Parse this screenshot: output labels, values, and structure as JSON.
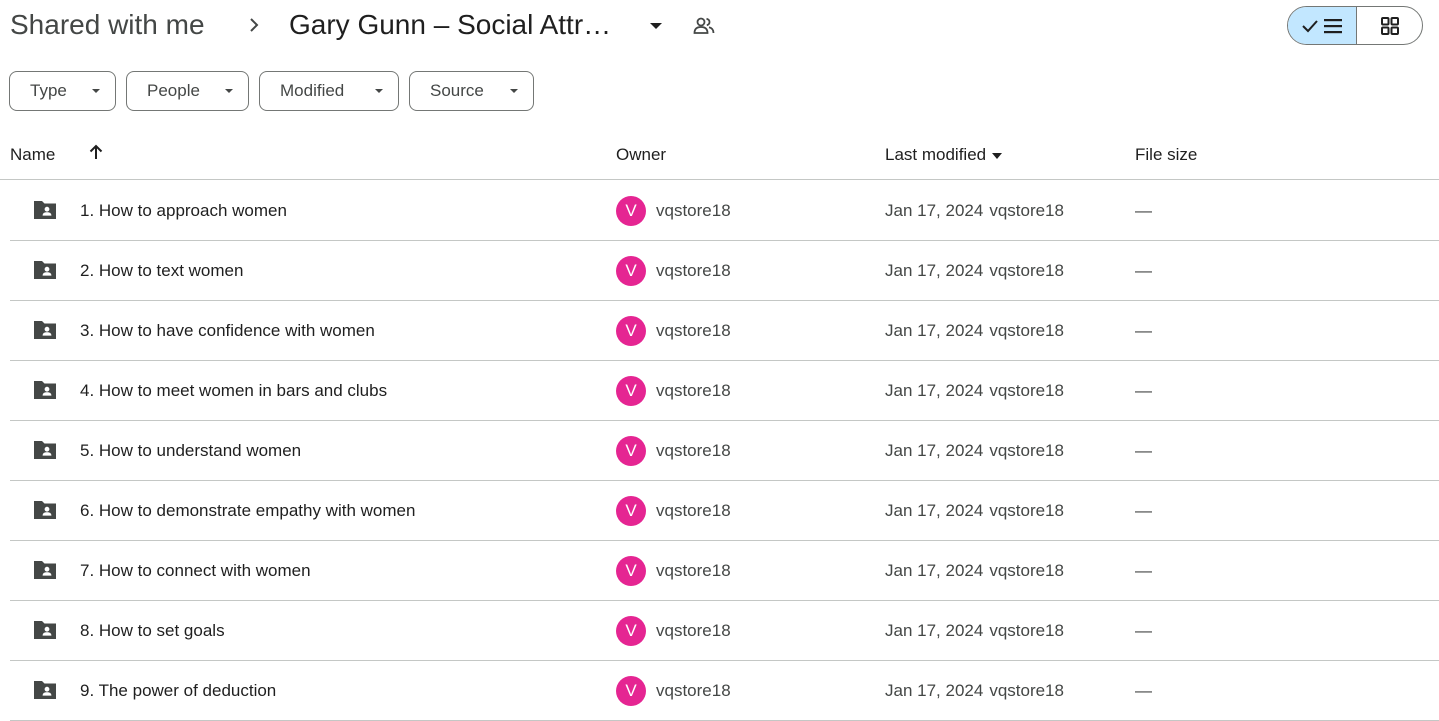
{
  "header": {
    "breadcrumb_root": "Shared with me",
    "breadcrumb_current": "Gary Gunn – Social Attr…",
    "separator_icon": "chevron-right-icon",
    "dropdown_icon": "caret-down-icon",
    "shared_icon": "people-icon"
  },
  "view_toggle": {
    "list_selected": true,
    "list_icons": [
      "check-icon",
      "list-icon"
    ],
    "grid_icon": "grid-icon",
    "selected_color": "#c2e7ff"
  },
  "filters": [
    {
      "label": "Type"
    },
    {
      "label": "People"
    },
    {
      "label": "Modified"
    },
    {
      "label": "Source"
    }
  ],
  "table": {
    "columns": {
      "name": "Name",
      "owner": "Owner",
      "last_modified": "Last modified",
      "file_size": "File size"
    },
    "sort": {
      "column": "name",
      "direction": "ascending",
      "icon": "arrow-up-icon"
    },
    "rows": [
      {
        "name": "1. How to approach women",
        "owner_initial": "V",
        "owner": "vqstore18",
        "modified_date": "Jan 17, 2024",
        "modified_by": "vqstore18",
        "size": "—"
      },
      {
        "name": "2. How to text women",
        "owner_initial": "V",
        "owner": "vqstore18",
        "modified_date": "Jan 17, 2024",
        "modified_by": "vqstore18",
        "size": "—"
      },
      {
        "name": "3. How to have confidence with women",
        "owner_initial": "V",
        "owner": "vqstore18",
        "modified_date": "Jan 17, 2024",
        "modified_by": "vqstore18",
        "size": "—"
      },
      {
        "name": "4. How to meet women in bars and clubs",
        "owner_initial": "V",
        "owner": "vqstore18",
        "modified_date": "Jan 17, 2024",
        "modified_by": "vqstore18",
        "size": "—"
      },
      {
        "name": "5. How to understand women",
        "owner_initial": "V",
        "owner": "vqstore18",
        "modified_date": "Jan 17, 2024",
        "modified_by": "vqstore18",
        "size": "—"
      },
      {
        "name": "6. How to demonstrate empathy with women",
        "owner_initial": "V",
        "owner": "vqstore18",
        "modified_date": "Jan 17, 2024",
        "modified_by": "vqstore18",
        "size": "—"
      },
      {
        "name": "7. How to connect with women",
        "owner_initial": "V",
        "owner": "vqstore18",
        "modified_date": "Jan 17, 2024",
        "modified_by": "vqstore18",
        "size": "—"
      },
      {
        "name": "8. How to set goals",
        "owner_initial": "V",
        "owner": "vqstore18",
        "modified_date": "Jan 17, 2024",
        "modified_by": "vqstore18",
        "size": "—"
      },
      {
        "name": "9. The power of deduction",
        "owner_initial": "V",
        "owner": "vqstore18",
        "modified_date": "Jan 17, 2024",
        "modified_by": "vqstore18",
        "size": "—"
      }
    ]
  },
  "colors": {
    "avatar": "#e52592",
    "folder_icon": "#444746",
    "divider": "#c4c7c5"
  },
  "icons": {
    "row_icon": "shared-folder-icon",
    "chip_caret": "caret-down-icon"
  }
}
